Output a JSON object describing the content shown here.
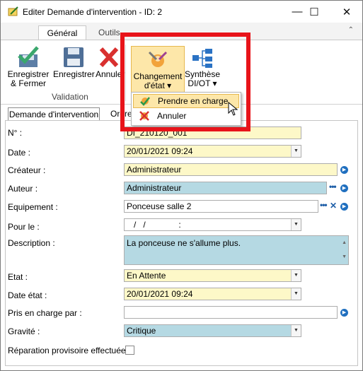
{
  "window": {
    "title": "Editer Demande d'intervention - ID: 2",
    "minimize_glyph": "—",
    "maximize_glyph": "☐",
    "close_glyph": "✕"
  },
  "ribbon": {
    "tabs": [
      {
        "label": "Général",
        "active": true
      },
      {
        "label": "Outils",
        "active": false
      }
    ],
    "buttons": {
      "save_close": {
        "line1": "Enregistrer",
        "line2": "& Fermer",
        "icon": "save-close-icon"
      },
      "save": {
        "label": "Enregistrer",
        "icon": "save-icon"
      },
      "cancel": {
        "label": "Annuler",
        "icon": "cancel-icon"
      },
      "change_state": {
        "line1": "Changement",
        "line2": "d'état ▾",
        "icon": "tools-icon"
      },
      "synthesis": {
        "line1": "Synthèse",
        "line2": "DI/OT ▾",
        "icon": "diagram-icon"
      }
    },
    "group_label": "Validation"
  },
  "dropdown_menu": {
    "items": [
      {
        "label": "Prendre en charge",
        "highlighted": true,
        "icon": "take-charge-icon"
      },
      {
        "label": "Annuler",
        "highlighted": false,
        "icon": "cancel-state-icon"
      }
    ]
  },
  "form_tabs": [
    {
      "label": "Demande d'intervention",
      "active": true
    },
    {
      "label": "Ordre",
      "active": false
    }
  ],
  "form": {
    "numero": {
      "label": "N° :",
      "value": "DI_210120_001"
    },
    "date": {
      "label": "Date :",
      "value": "20/01/2021 09:24"
    },
    "createur": {
      "label": "Créateur :",
      "value": "Administrateur"
    },
    "auteur": {
      "label": "Auteur :",
      "value": "Administrateur"
    },
    "equipement": {
      "label": "Equipement :",
      "value": "Ponceuse salle 2"
    },
    "pour_le": {
      "label": "Pour le :",
      "value": "   /   /              :"
    },
    "description": {
      "label": "Description :",
      "value": "La ponceuse ne s'allume plus."
    },
    "etat": {
      "label": "Etat :",
      "value": "En Attente"
    },
    "date_etat": {
      "label": "Date état :",
      "value": "20/01/2021 09:24"
    },
    "pris_en_charge": {
      "label": "Pris en charge par :",
      "value": ""
    },
    "gravite": {
      "label": "Gravité :",
      "value": "Critique"
    },
    "reparation": {
      "label": "Réparation provisoire effectuée :",
      "checked": false
    }
  },
  "colors": {
    "highlight": "#e8141a",
    "field_yellow": "#fdf8c8",
    "field_blue": "#b5d9e3",
    "menu_highlight": "#fde7a9"
  }
}
